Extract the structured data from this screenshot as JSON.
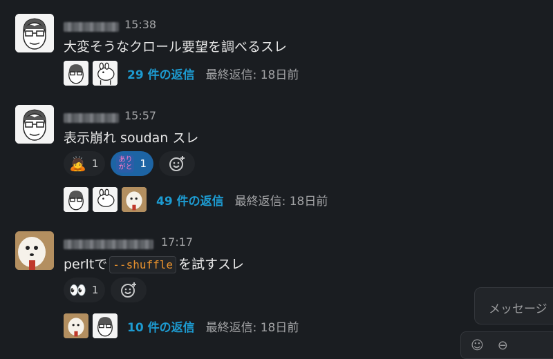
{
  "messages": [
    {
      "time": "15:38",
      "text": "大変そうなクロール要望を調べるスレ",
      "thread": {
        "replies": "29 件の返信",
        "last_reply": "最終返信: 18日前"
      }
    },
    {
      "time": "15:57",
      "text": "表示崩れ soudan スレ",
      "reactions": [
        {
          "emoji": "bowing-person",
          "count": "1"
        },
        {
          "emoji_text": "ありがと",
          "count": "1"
        }
      ],
      "thread": {
        "replies": "49 件の返信",
        "last_reply": "最終返信: 18日前"
      }
    },
    {
      "time": "17:17",
      "text_prefix": "perltで",
      "code": "--shuffle",
      "text_suffix": "を試すスレ",
      "reactions": [
        {
          "emoji": "eyes",
          "count": "1"
        }
      ],
      "thread": {
        "replies": "10 件の返信",
        "last_reply": "最終返信: 18日前"
      }
    }
  ],
  "composer": {
    "placeholder": "メッセージ"
  },
  "colors": {
    "background": "#1a1d21",
    "link": "#1d9bd1",
    "reaction_active": "#1d64a4",
    "code": "#e8912d"
  }
}
